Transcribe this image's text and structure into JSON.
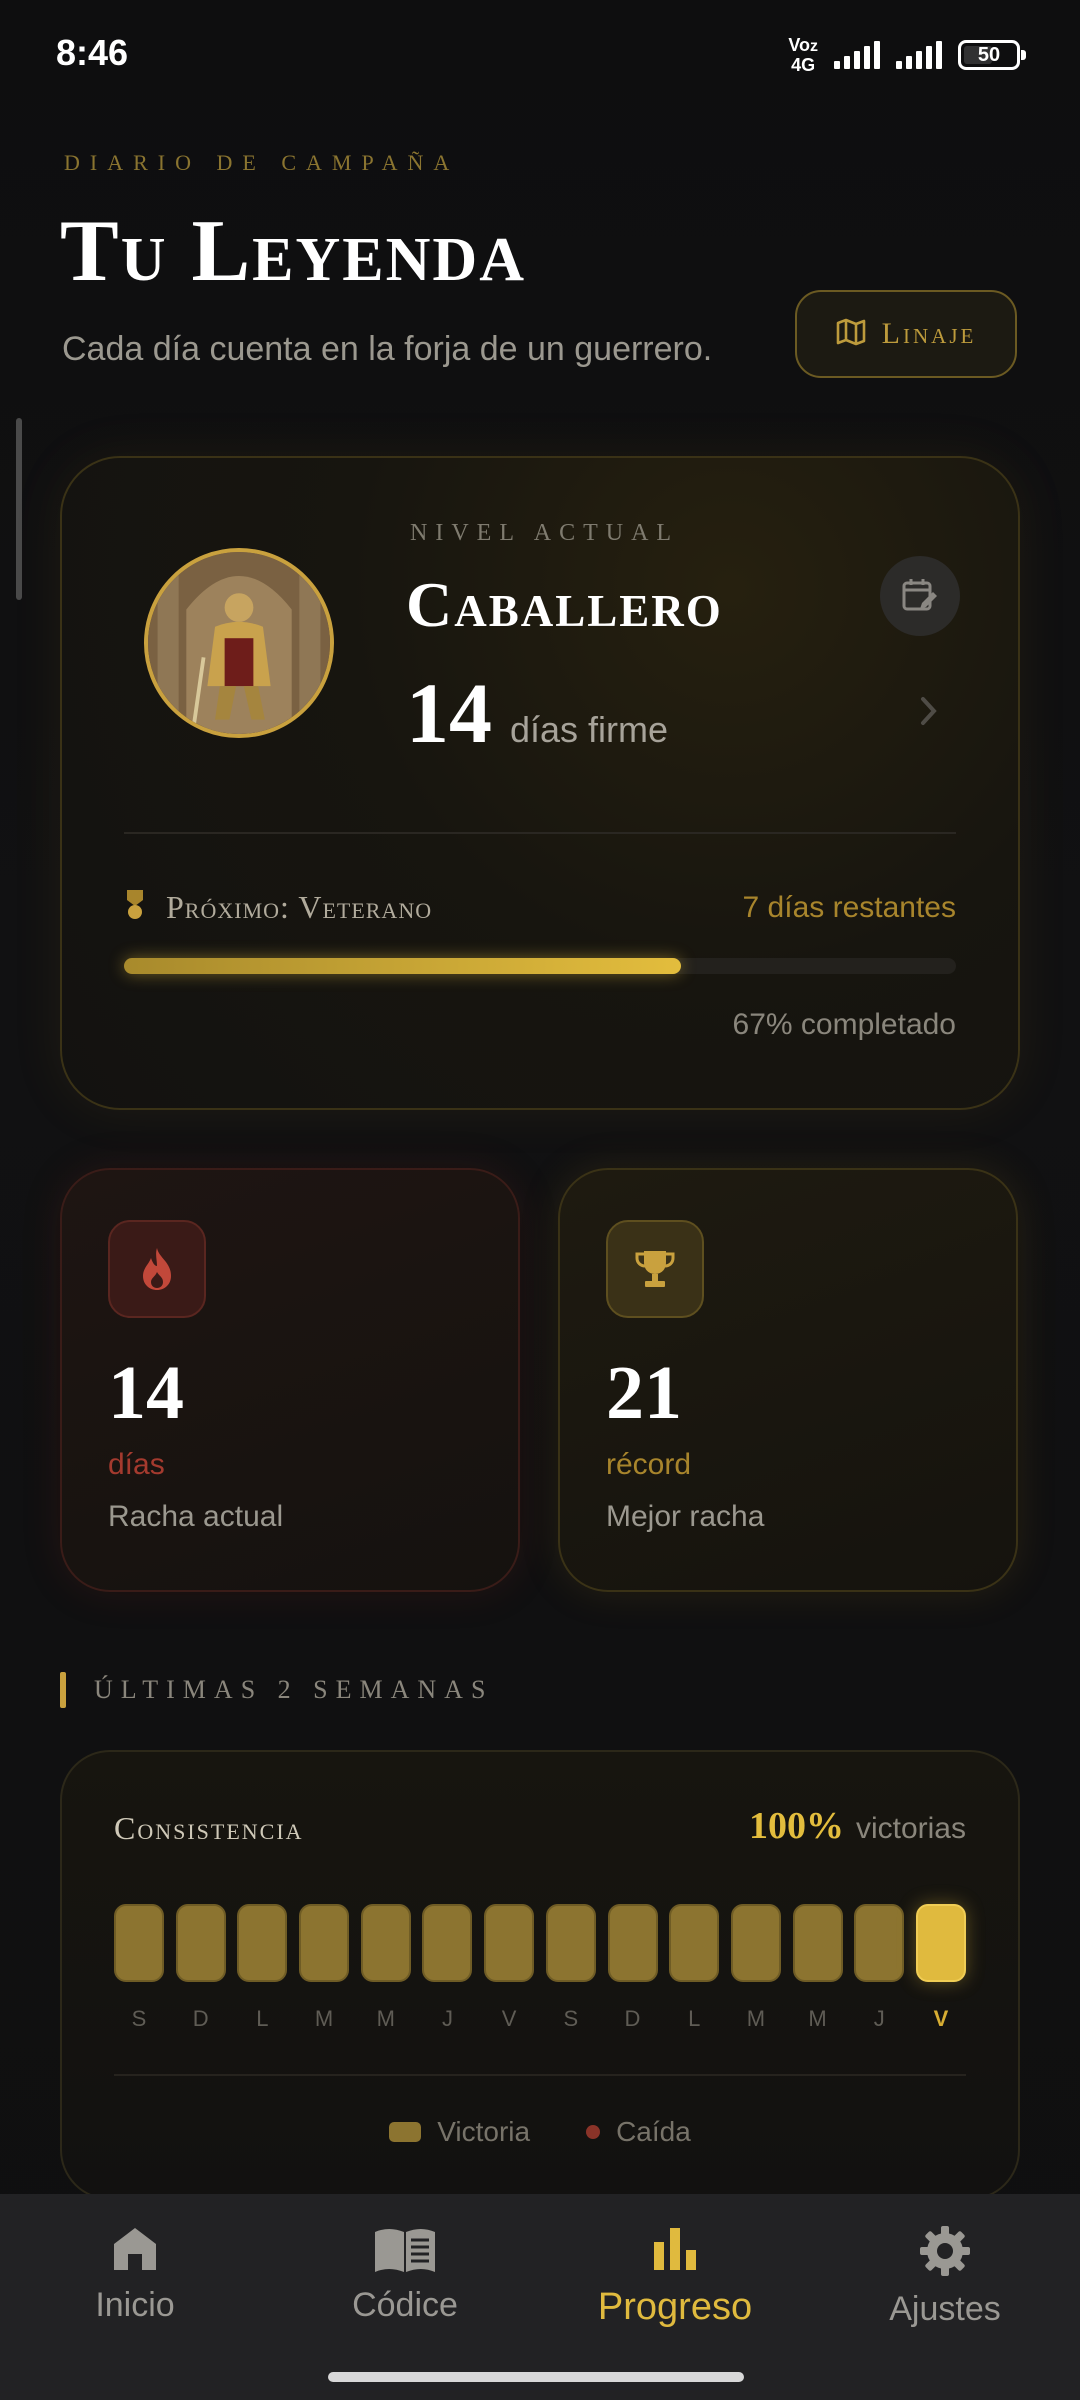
{
  "status_bar": {
    "time": "8:46",
    "network": "Voz 4G",
    "battery": "50"
  },
  "header": {
    "eyebrow": "DIARIO DE CAMPAÑA",
    "title": "Tu Leyenda",
    "subtitle": "Cada día cuenta en la forja de un guerrero.",
    "lineage_button": "Linaje"
  },
  "level": {
    "eyebrow": "NIVEL ACTUAL",
    "name": "Caballero",
    "days": "14",
    "days_unit": "días firme",
    "next_label": "Próximo: Veterano",
    "remaining": "7 días restantes",
    "progress_fraction": 0.67,
    "progress_text": "67% completado"
  },
  "stats": {
    "streak": {
      "value": "14",
      "unit": "días",
      "caption": "Racha actual",
      "icon": "flame-icon"
    },
    "record": {
      "value": "21",
      "unit": "récord",
      "caption": "Mejor racha",
      "icon": "trophy-icon"
    }
  },
  "weeks": {
    "heading": "ÚLTIMAS 2 SEMANAS",
    "title": "Consistencia",
    "percent": "100%",
    "percent_label": "victorias",
    "days": [
      {
        "letter": "S",
        "result": "victoria"
      },
      {
        "letter": "D",
        "result": "victoria"
      },
      {
        "letter": "L",
        "result": "victoria"
      },
      {
        "letter": "M",
        "result": "victoria"
      },
      {
        "letter": "M",
        "result": "victoria"
      },
      {
        "letter": "J",
        "result": "victoria"
      },
      {
        "letter": "V",
        "result": "victoria"
      },
      {
        "letter": "S",
        "result": "victoria"
      },
      {
        "letter": "D",
        "result": "victoria"
      },
      {
        "letter": "L",
        "result": "victoria"
      },
      {
        "letter": "M",
        "result": "victoria"
      },
      {
        "letter": "M",
        "result": "victoria"
      },
      {
        "letter": "J",
        "result": "victoria"
      },
      {
        "letter": "V",
        "result": "victoria",
        "today": true
      }
    ],
    "legend": {
      "win": "Victoria",
      "fall": "Caída"
    }
  },
  "nav": {
    "items": [
      {
        "label": "Inicio",
        "icon": "home-icon"
      },
      {
        "label": "Códice",
        "icon": "book-icon"
      },
      {
        "label": "Progreso",
        "icon": "bar-chart-icon",
        "active": true
      },
      {
        "label": "Ajustes",
        "icon": "gear-icon"
      }
    ]
  },
  "colors": {
    "gold": "#e0ba3e",
    "ember": "#a43a2e",
    "background": "#0e0e0f"
  }
}
